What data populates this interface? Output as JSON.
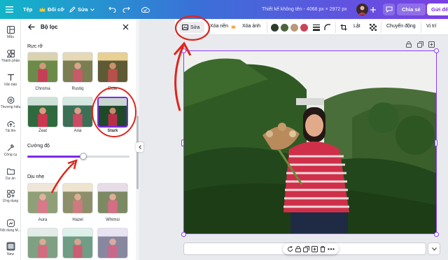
{
  "topbar": {
    "home": "Tệp",
    "resize": "Đổi cỡ",
    "edit": "Sửa",
    "design_title": "Thiết kế không tên - 4068 px × 2972 px",
    "share": "Chia sẻ",
    "send": "Gửi đế"
  },
  "rail": [
    {
      "label": "Mẫu",
      "icon": "template-icon"
    },
    {
      "label": "Thành phần",
      "icon": "elements-icon"
    },
    {
      "label": "Văn bản",
      "icon": "text-icon"
    },
    {
      "label": "Thương hiệu",
      "icon": "brand-icon"
    },
    {
      "label": "Tải lên",
      "icon": "upload-icon"
    },
    {
      "label": "Công cụ",
      "icon": "tools-icon"
    },
    {
      "label": "Dự án",
      "icon": "projects-icon"
    },
    {
      "label": "Ứng dụng",
      "icon": "apps-icon"
    },
    {
      "label": "Nội dung M...",
      "icon": "content-icon"
    },
    {
      "label": "New",
      "icon": "new-icon"
    }
  ],
  "panel": {
    "title": "Bộ lọc",
    "section_vivid": "Rực rỡ",
    "vivid_filters": [
      "Chroma",
      "Rustiq",
      "Eldar",
      "Zeal",
      "Aria",
      "Stark"
    ],
    "intensity_label": "Cường độ",
    "intensity_value": 0.55,
    "section_soft": "Dịu nhẹ",
    "soft_filters": [
      "Aura",
      "Hazel",
      "Whimsi"
    ]
  },
  "canvas_toolbar": {
    "edit": "Sửa",
    "remove_bg": "Xóa nền",
    "erase": "Xóa ảnh",
    "flip": "Lật",
    "animate": "Chuyển động",
    "position": "Vị trí"
  },
  "colors": {
    "swatches": [
      "#2d3b2c",
      "#4d6340",
      "#b89a78",
      "#c8445a"
    ],
    "accent": "#7d2ae8",
    "annotation": "#e0241b"
  }
}
